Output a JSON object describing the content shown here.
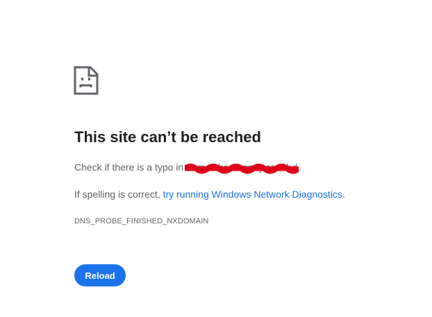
{
  "icon": "sad-page-icon",
  "title": "This site can’t be reached",
  "typo_line": {
    "prefix": "Check if there is a typo in ",
    "domain": "demo.shomonnoy.com.bd",
    "suffix": "."
  },
  "spelling_line": {
    "prefix": "If spelling is correct, ",
    "link": "try running Windows Network Diagnostics",
    "suffix": "."
  },
  "error_code": "DNS_PROBE_FINISHED_NXDOMAIN",
  "reload_label": "Reload",
  "colors": {
    "text": "#5f6368",
    "title": "#202124",
    "link": "#1a73e8",
    "button": "#1a73e8",
    "redaction": "#e0001a"
  }
}
